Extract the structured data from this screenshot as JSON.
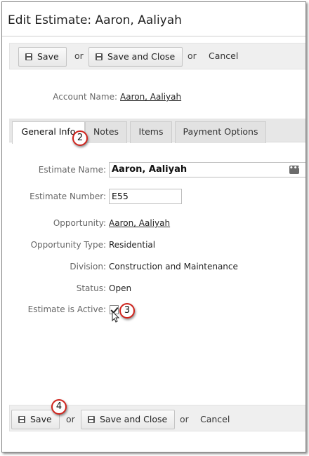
{
  "page": {
    "title": "Edit Estimate: Aaron, Aaliyah"
  },
  "toolbar_top": {
    "save_label": "Save",
    "or1": "or",
    "save_close_label": "Save and Close",
    "or2": "or",
    "cancel_label": "Cancel"
  },
  "account": {
    "label": "Account Name:",
    "value": "Aaron, Aaliyah"
  },
  "tabs": [
    {
      "label": "General Info"
    },
    {
      "label": "Notes"
    },
    {
      "label": "Items"
    },
    {
      "label": "Payment Options"
    }
  ],
  "form": {
    "estimate_name_label": "Estimate Name:",
    "estimate_name_value": "Aaron, Aaliyah",
    "estimate_number_label": "Estimate Number:",
    "estimate_number_value": "E55",
    "opportunity_label": "Opportunity:",
    "opportunity_value": "Aaron, Aaliyah",
    "opportunity_type_label": "Opportunity Type:",
    "opportunity_type_value": "Residential",
    "division_label": "Division:",
    "division_value": "Construction and Maintenance",
    "status_label": "Status:",
    "status_value": "Open",
    "active_label": "Estimate is Active:",
    "active_checked": true
  },
  "callouts": {
    "c2": "2",
    "c3": "3",
    "c4": "4"
  },
  "toolbar_bottom": {
    "save_label": "Save",
    "or1": "or",
    "save_close_label": "Save and Close",
    "or2": "or",
    "cancel_label": "Cancel"
  },
  "colors": {
    "callout_border": "#d0231c",
    "toolbar_bg": "#efefef"
  }
}
